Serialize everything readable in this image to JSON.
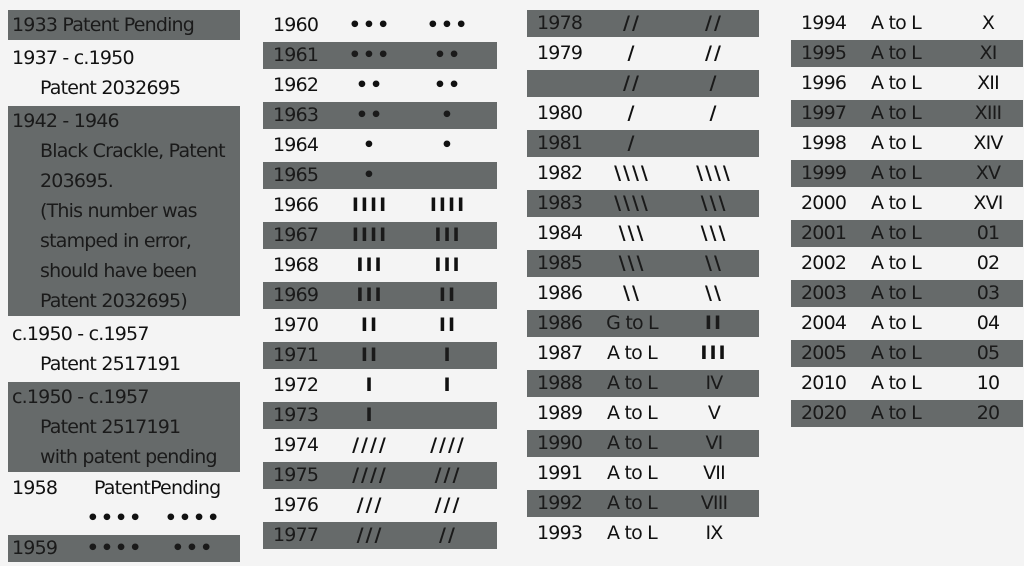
{
  "colors": {
    "shade": "#666a6a",
    "background": "#f4f4f4",
    "text": "#111111"
  },
  "column1": {
    "entries": [
      {
        "lines": [
          "1933   Patent Pending"
        ],
        "shaded": true
      },
      {
        "lines": [
          "1937 - c.1950",
          "Patent 2032695"
        ],
        "shaded": false
      },
      {
        "lines": [
          "1942 - 1946",
          "Black Crackle, Patent",
          "203695.",
          "(This number was",
          "stamped in error,",
          "should have been",
          "Patent 2032695)"
        ],
        "shaded": true
      },
      {
        "lines": [
          "c.1950 - c.1957",
          "Patent 2517191"
        ],
        "shaded": false
      },
      {
        "lines": [
          "c.1950 - c.1957",
          "Patent 2517191",
          "with patent pending"
        ],
        "shaded": true
      }
    ],
    "row1958": {
      "year": "1958",
      "desc": "PatentPending",
      "mark1": "••••",
      "mark2": "••••"
    },
    "row1959": {
      "year": "1959",
      "mark1": "••••",
      "mark2": "•••"
    }
  },
  "column2": [
    {
      "year": "1960",
      "code1": "•••",
      "code2": "•••",
      "shaded": false
    },
    {
      "year": "1961",
      "code1": "•••",
      "code2": "••",
      "shaded": true
    },
    {
      "year": "1962",
      "code1": "••",
      "code2": "••",
      "shaded": false
    },
    {
      "year": "1963",
      "code1": "••",
      "code2": "•",
      "shaded": true
    },
    {
      "year": "1964",
      "code1": "•",
      "code2": "•",
      "shaded": false
    },
    {
      "year": "1965",
      "code1": "•",
      "code2": "",
      "shaded": true
    },
    {
      "year": "1966",
      "code1": "IIII",
      "code2": "IIII",
      "shaded": false
    },
    {
      "year": "1967",
      "code1": "IIII",
      "code2": "III",
      "shaded": true
    },
    {
      "year": "1968",
      "code1": "III",
      "code2": "III",
      "shaded": false
    },
    {
      "year": "1969",
      "code1": "III",
      "code2": "II",
      "shaded": true
    },
    {
      "year": "1970",
      "code1": "II",
      "code2": "II",
      "shaded": false
    },
    {
      "year": "1971",
      "code1": "II",
      "code2": "I",
      "shaded": true
    },
    {
      "year": "1972",
      "code1": "I",
      "code2": "I",
      "shaded": false
    },
    {
      "year": "1973",
      "code1": "I",
      "code2": "",
      "shaded": true
    },
    {
      "year": "1974",
      "code1": "////",
      "code2": "////",
      "shaded": false
    },
    {
      "year": "1975",
      "code1": "////",
      "code2": "///",
      "shaded": true
    },
    {
      "year": "1976",
      "code1": "///",
      "code2": "///",
      "shaded": false
    },
    {
      "year": "1977",
      "code1": "///",
      "code2": "//",
      "shaded": true
    }
  ],
  "column3": [
    {
      "year": "1978",
      "code1": "//",
      "code2": "//",
      "shaded": true
    },
    {
      "year": "1979",
      "code1": "/",
      "code2": "//",
      "shaded": false
    },
    {
      "year": "",
      "code1": "//",
      "code2": "/",
      "shaded": true
    },
    {
      "year": "1980",
      "code1": "/",
      "code2": "/",
      "shaded": false
    },
    {
      "year": "1981",
      "code1": "/",
      "code2": "",
      "shaded": true
    },
    {
      "year": "1982",
      "code1": "\\\\\\\\",
      "code2": "\\\\\\\\",
      "shaded": false
    },
    {
      "year": "1983",
      "code1": "\\\\\\\\",
      "code2": "\\\\\\",
      "shaded": true
    },
    {
      "year": "1984",
      "code1": "\\\\\\",
      "code2": "\\\\\\",
      "shaded": false
    },
    {
      "year": "1985",
      "code1": "\\\\\\",
      "code2": "\\\\",
      "shaded": true
    },
    {
      "year": "1986",
      "code1": "\\\\",
      "code2": "\\\\",
      "shaded": false
    },
    {
      "year": "1986",
      "code1": "G to L",
      "code2": "II",
      "shaded": true
    },
    {
      "year": "1987",
      "code1": "A to L",
      "code2": "III",
      "shaded": false
    },
    {
      "year": "1988",
      "code1": "A to L",
      "code2": "IV",
      "shaded": true
    },
    {
      "year": "1989",
      "code1": "A to L",
      "code2": "V",
      "shaded": false
    },
    {
      "year": "1990",
      "code1": "A to L",
      "code2": "VI",
      "shaded": true
    },
    {
      "year": "1991",
      "code1": "A to L",
      "code2": "VII",
      "shaded": false
    },
    {
      "year": "1992",
      "code1": "A to L",
      "code2": "VIII",
      "shaded": true
    },
    {
      "year": "1993",
      "code1": "A to L",
      "code2": "IX",
      "shaded": false
    }
  ],
  "column4": [
    {
      "year": "1994",
      "code1": "A to L",
      "code2": "X",
      "shaded": false
    },
    {
      "year": "1995",
      "code1": "A to L",
      "code2": "XI",
      "shaded": true
    },
    {
      "year": "1996",
      "code1": "A to L",
      "code2": "XII",
      "shaded": false
    },
    {
      "year": "1997",
      "code1": "A to L",
      "code2": "XIII",
      "shaded": true
    },
    {
      "year": "1998",
      "code1": "A to L",
      "code2": "XIV",
      "shaded": false
    },
    {
      "year": "1999",
      "code1": "A to L",
      "code2": "XV",
      "shaded": true
    },
    {
      "year": "2000",
      "code1": "A to L",
      "code2": "XVI",
      "shaded": false
    },
    {
      "year": "2001",
      "code1": "A to L",
      "code2": "01",
      "shaded": true
    },
    {
      "year": "2002",
      "code1": "A to L",
      "code2": "02",
      "shaded": false
    },
    {
      "year": "2003",
      "code1": "A to L",
      "code2": "03",
      "shaded": true
    },
    {
      "year": "2004",
      "code1": "A to L",
      "code2": "04",
      "shaded": false
    },
    {
      "year": "2005",
      "code1": "A to L",
      "code2": "05",
      "shaded": true
    },
    {
      "year": "2010",
      "code1": "A to L",
      "code2": "10",
      "shaded": false
    },
    {
      "year": "2020",
      "code1": "A to L",
      "code2": "20",
      "shaded": true
    }
  ]
}
